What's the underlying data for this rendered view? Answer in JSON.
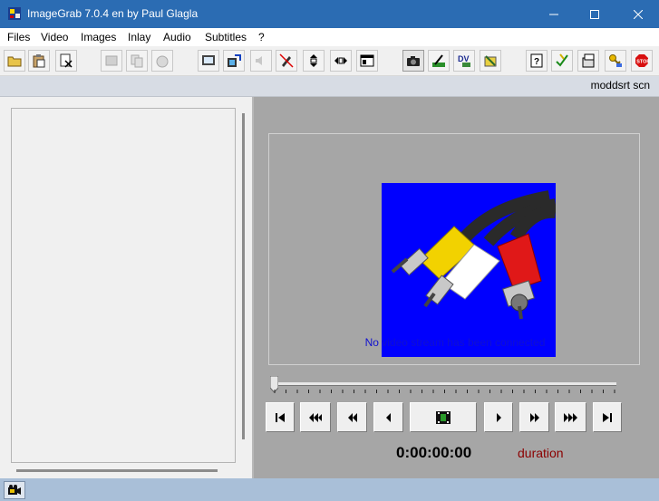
{
  "window": {
    "title": "ImageGrab 7.0.4 en by Paul Glagla"
  },
  "menu": [
    "Files",
    "Video",
    "Images",
    "Inlay",
    "Audio",
    "Subtitles",
    "?"
  ],
  "toolbar": {
    "icons": [
      "open-folder-icon",
      "paste-icon",
      "close-file-icon",
      "capture-disabled-icon",
      "copy-disabled-icon",
      "timer-disabled-icon",
      "screen-icon",
      "export-icon",
      "volume-disabled-icon",
      "no-edit-icon",
      "fit-vertical-icon",
      "fit-horizontal-icon",
      "window-icon",
      "camera-icon",
      "crop-icon",
      "dv-icon",
      "adjust-icon",
      "help-icon",
      "check-icon",
      "settings-icon",
      "keys-icon",
      "stop-icon"
    ]
  },
  "status_strip": {
    "text": "moddsrt scn"
  },
  "video": {
    "message": "No video stream has been connected"
  },
  "player": {
    "timecode": "0:00:00:00",
    "duration_label": "duration",
    "position": 0
  },
  "colors": {
    "title_bar": "#2b6cb3",
    "video_background": "#0000fe",
    "message": "#1010d0",
    "duration": "#8b0000"
  }
}
